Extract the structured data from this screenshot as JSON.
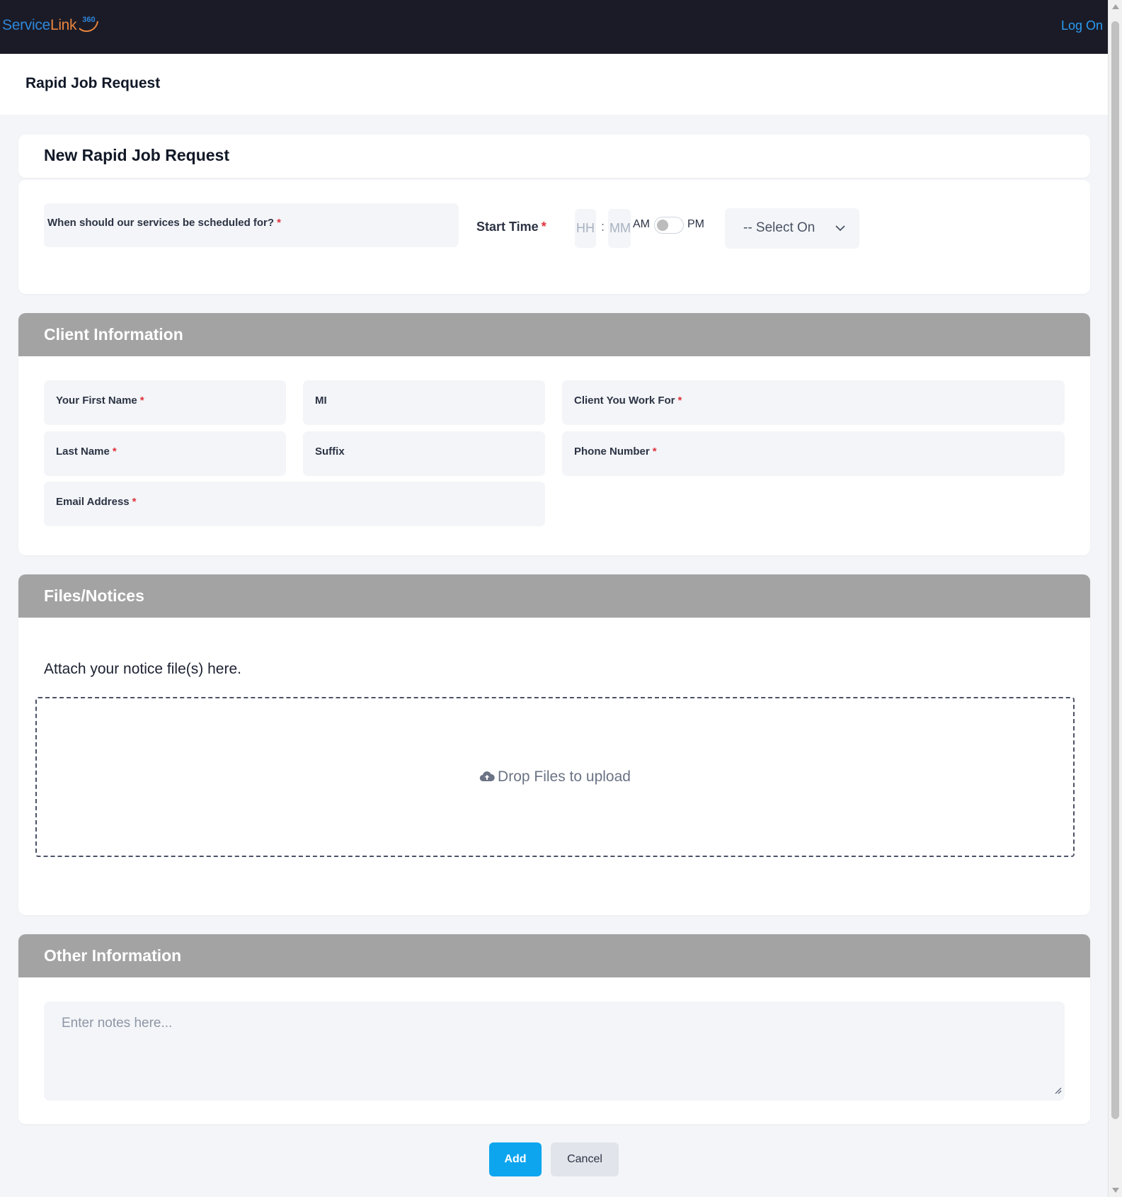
{
  "header": {
    "brand_service": "ServiceLink",
    "brand_360": "360",
    "login_label": "Log On"
  },
  "page": {
    "title": "Rapid Job Request"
  },
  "schedule": {
    "card_title": "New Rapid Job Request",
    "date_label": "When should our services be scheduled for?",
    "start_time_label": "Start Time",
    "hour_placeholder": "HH",
    "minute_placeholder": "MM",
    "separator": ":",
    "am_label": "AM",
    "pm_label": "PM",
    "pm_selected": false,
    "select_value": "-- Select On",
    "required_mark": "*"
  },
  "client": {
    "title": "Client Information",
    "fields": {
      "first_name": "Your First Name",
      "mi": "MI",
      "client_for": "Client You Work For",
      "last_name": "Last Name",
      "suffix": "Suffix",
      "phone": "Phone Number",
      "email": "Email Address"
    }
  },
  "files": {
    "title": "Files/Notices",
    "instruction": "Attach your notice file(s) here.",
    "drop_text": "Drop Files to upload"
  },
  "other": {
    "title": "Other Information",
    "notes_placeholder": "Enter notes here..."
  },
  "actions": {
    "add_label": "Add",
    "cancel_label": "Cancel"
  },
  "colors": {
    "topbar": "#1b1b27",
    "section_header": "#a3a3a3",
    "primary": "#0ea5ef",
    "required": "#e0313b",
    "link": "#2a9cf3"
  }
}
